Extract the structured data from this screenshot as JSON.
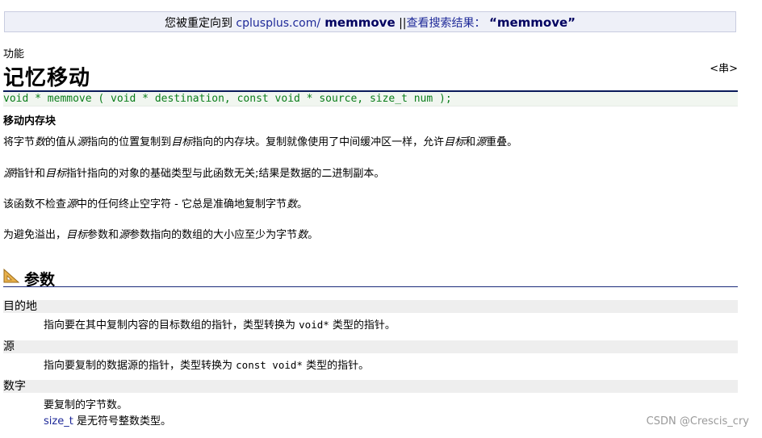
{
  "redirect": {
    "prefix": "您被重定向到 ",
    "site": "cplusplus.com/",
    "keyword": " memmove",
    "sep": " ||",
    "search_label": "查看搜索结果：",
    "query": "“memmove”"
  },
  "header": {
    "category": "功能",
    "title": "记忆移动",
    "type": "<串>"
  },
  "prototype": "void * memmove ( void * destination, const void * source, size_t num );",
  "summary": "移动内存块",
  "paragraphs": {
    "p1": {
      "a": "将字节",
      "b": "数",
      "c": "的值从",
      "d": "源",
      "e": "指向的位置复制到",
      "f": "目标",
      "g": "指向的内存块。复制就像使用了中间缓冲区一样，允许",
      "h": "目标",
      "i": "和",
      "j": "源",
      "k": "重叠。"
    },
    "p2": {
      "a": "源",
      "b": "指针和",
      "c": "目标",
      "d": "指针指向的对象的基础类型与此函数无关;结果是数据的二进制副本。"
    },
    "p3": {
      "a": "该函数不检查",
      "b": "源",
      "c": "中的任何终止空字符 - 它总是准确地复制字节",
      "d": "数",
      "e": "。"
    },
    "p4": {
      "a": "为避免溢出，",
      "b": "目标",
      "c": "参数和",
      "d": "源",
      "e": "参数指向的数组的大小应至少为字节",
      "f": "数",
      "g": "。"
    }
  },
  "params": {
    "title": "参数",
    "items": [
      {
        "name": "目的地",
        "desc_a": "指向要在其中复制内容的目标数组的指针，类型转换为 ",
        "code": "void*",
        "desc_b": " 类型的指针。"
      },
      {
        "name": "源",
        "desc_a": "指向要复制的数据源的指针，类型转换为 ",
        "code": "const void*",
        "desc_b": " 类型的指针。"
      },
      {
        "name": "数字",
        "line1": "要复制的字节数。",
        "link": "size_t",
        "line2": " 是无符号整数类型。"
      }
    ]
  },
  "watermark": "CSDN @Crescis_cry",
  "colors": {
    "prototype": "#0a7d1a",
    "link": "#1f2a99",
    "rule": "#0a1a5a",
    "param_bg": "#eeeeee"
  }
}
